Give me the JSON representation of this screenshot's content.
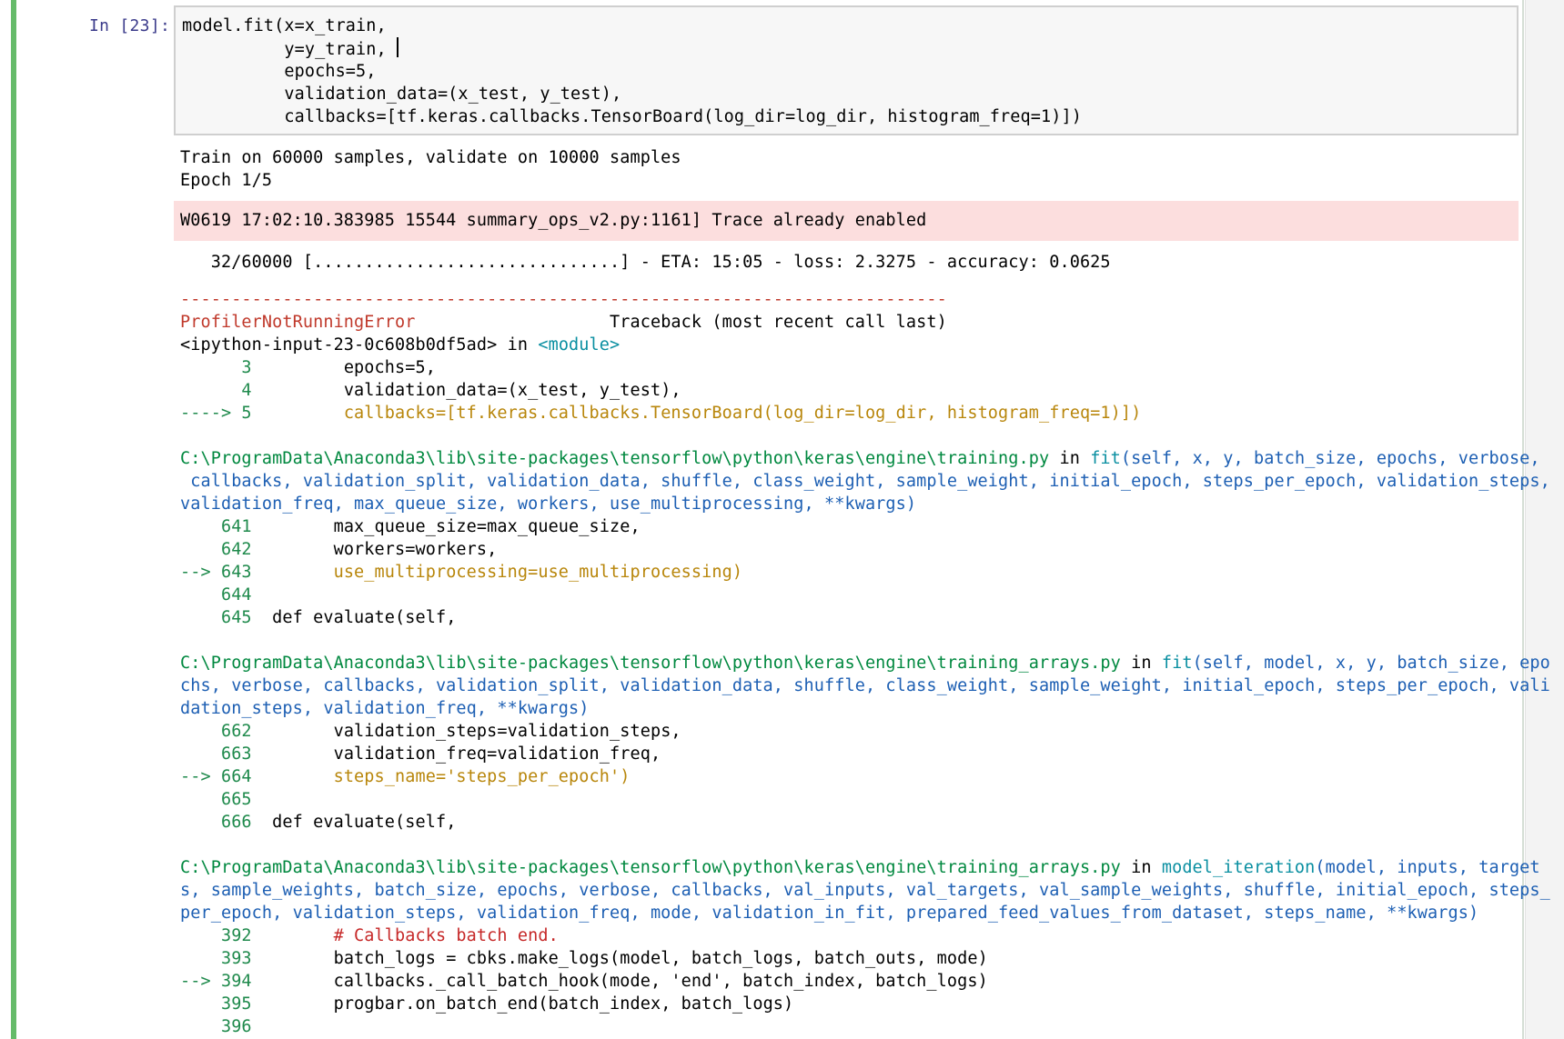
{
  "prompt": "In [23]:",
  "code_lines": [
    {
      "text": "model.fit(x=x_train,",
      "cursor": false
    },
    {
      "text": "          y=y_train, ",
      "cursor": true
    },
    {
      "text": "          epochs=5,",
      "cursor": false
    },
    {
      "text": "          validation_data=(x_test, y_test),",
      "cursor": false
    },
    {
      "text": "          callbacks=[tf.keras.callbacks.TensorBoard(log_dir=log_dir, histogram_freq=1)])",
      "cursor": false
    }
  ],
  "stdout_lines": [
    "Train on 60000 samples, validate on 10000 samples",
    "Epoch 1/5"
  ],
  "stderr_text": "W0619 17:02:10.383985 15544 summary_ops_v2.py:1161] Trace already enabled",
  "progress_text": "   32/60000 [..............................] - ETA: 15:05 - loss: 2.3275 - accuracy: 0.0625",
  "traceback": {
    "dashes": "---------------------------------------------------------------------------",
    "error_name": "ProfilerNotRunningError",
    "header_rest": "                   Traceback (most recent call last)",
    "input_location": "<ipython-input-23-0c608b0df5ad>",
    "in_word": " in ",
    "module": "<module>",
    "input_frame": [
      {
        "num": "      3",
        "code": "         epochs=5,",
        "current": false
      },
      {
        "num": "      4",
        "code": "         validation_data=(x_test, y_test),",
        "current": false
      },
      {
        "num": "----> 5",
        "code": "         callbacks=[tf.keras.callbacks.TensorBoard(log_dir=log_dir, histogram_freq=1)])",
        "current": true
      }
    ],
    "frames": [
      {
        "path": "C:\\ProgramData\\Anaconda3\\lib\\site-packages\\tensorflow\\python\\keras\\engine\\training.py",
        "func": "fit",
        "sig_lines": [
          "(self, x, y, batch_size, epochs, verbose,",
          " callbacks, validation_split, validation_data, shuffle, class_weight, sample_weight, initial_epoch, steps_per_epoch, validation_steps,",
          "validation_freq, max_queue_size, workers, use_multiprocessing, **kwargs)"
        ],
        "lines": [
          {
            "num": "    641",
            "code": "        max_queue_size=max_queue_size,",
            "current": false
          },
          {
            "num": "    642",
            "code": "        workers=workers,",
            "current": false
          },
          {
            "num": "--> 643",
            "code": "        use_multiprocessing=use_multiprocessing)",
            "current": true
          },
          {
            "num": "    644",
            "code": "",
            "current": false
          },
          {
            "num": "    645",
            "code": "  def evaluate(self,",
            "current": false
          }
        ]
      },
      {
        "path": "C:\\ProgramData\\Anaconda3\\lib\\site-packages\\tensorflow\\python\\keras\\engine\\training_arrays.py",
        "func": "fit",
        "sig_lines": [
          "(self, model, x, y, batch_size, epo",
          "chs, verbose, callbacks, validation_split, validation_data, shuffle, class_weight, sample_weight, initial_epoch, steps_per_epoch, vali",
          "dation_steps, validation_freq, **kwargs)"
        ],
        "lines": [
          {
            "num": "    662",
            "code": "        validation_steps=validation_steps,",
            "current": false
          },
          {
            "num": "    663",
            "code": "        validation_freq=validation_freq,",
            "current": false
          },
          {
            "num": "--> 664",
            "code": "        steps_name='steps_per_epoch')",
            "current": true
          },
          {
            "num": "    665",
            "code": "",
            "current": false
          },
          {
            "num": "    666",
            "code": "  def evaluate(self,",
            "current": false
          }
        ]
      },
      {
        "path": "C:\\ProgramData\\Anaconda3\\lib\\site-packages\\tensorflow\\python\\keras\\engine\\training_arrays.py",
        "func": "model_iteration",
        "sig_lines": [
          "(model, inputs, target",
          "s, sample_weights, batch_size, epochs, verbose, callbacks, val_inputs, val_targets, val_sample_weights, shuffle, initial_epoch, steps_",
          "per_epoch, validation_steps, validation_freq, mode, validation_in_fit, prepared_feed_values_from_dataset, steps_name, **kwargs)"
        ],
        "lines": [
          {
            "num": "    392",
            "code": "        # Callbacks batch end.",
            "current": false,
            "comment": true
          },
          {
            "num": "    393",
            "code": "        batch_logs = cbks.make_logs(model, batch_logs, batch_outs, mode)",
            "current": false
          },
          {
            "num": "--> 394",
            "code": "        callbacks._call_batch_hook(mode, 'end', batch_index, batch_logs)",
            "current": false
          },
          {
            "num": "    395",
            "code": "        progbar.on_batch_end(batch_index, batch_logs)",
            "current": false
          },
          {
            "num": "    396",
            "code": "",
            "current": false
          }
        ]
      }
    ]
  },
  "colors": {
    "cell_stripe": "#66bb6a",
    "stderr_bg": "#fcdede",
    "error_red": "#c0392b",
    "path_green": "#00883f",
    "signature_blue": "#1d5fb3",
    "func_cyan": "#0a8fa1",
    "current_line": "#b8860b"
  }
}
